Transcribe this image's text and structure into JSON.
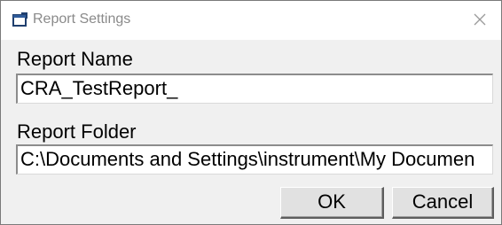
{
  "window": {
    "title": "Report Settings",
    "icon": "report-window-icon",
    "close_icon": "close-icon"
  },
  "report_name": {
    "label": "Report Name",
    "value": "CRA_TestReport_"
  },
  "report_folder": {
    "label": "Report Folder",
    "value": "C:\\Documents and Settings\\instrument\\My Documen"
  },
  "buttons": {
    "ok_label": "OK",
    "cancel_label": "Cancel"
  }
}
